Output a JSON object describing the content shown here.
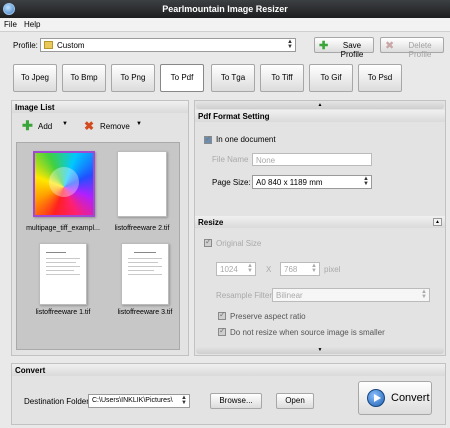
{
  "window": {
    "title": "Pearlmountain Image Resizer"
  },
  "menu": {
    "file": "File",
    "help": "Help"
  },
  "profile": {
    "label": "Profile:",
    "value": "Custom",
    "save": "Save Profile",
    "delete": "Delete Profile"
  },
  "tabs": [
    "To Jpeg",
    "To Bmp",
    "To Png",
    "To Pdf",
    "To Tga",
    "To Tiff",
    "To Gif",
    "To Psd"
  ],
  "active_tab": "To Pdf",
  "image_list": {
    "title": "Image List",
    "add": "Add",
    "remove": "Remove",
    "items": [
      "multipage_tiff_exampl...",
      "listoffreeware 2.tif",
      "listoffreeware 1.tif",
      "listoffreeware 3.tif"
    ]
  },
  "pdf": {
    "title": "Pdf Format Setting",
    "one_document": "In one document",
    "file_name_label": "File Name",
    "file_name_value": "None",
    "page_size_label": "Page Size:",
    "page_size_value": "A0 840 x 1189 mm"
  },
  "resize": {
    "title": "Resize",
    "original_size": "Original Size",
    "width": "1024",
    "x": "X",
    "height": "768",
    "unit": "pixel",
    "filter_label": "Resample Filter",
    "filter_value": "Bilinear",
    "aspect": "Preserve aspect ratio",
    "no_resize": "Do not resize when source image is smaller"
  },
  "convert": {
    "title": "Convert",
    "dest_label": "Destination Folder:",
    "dest_value": "C:\\Users\\INKLIK\\Pictures\\",
    "browse": "Browse...",
    "open": "Open",
    "convert": "Convert"
  },
  "colors": {
    "titlebar": "#2a2b2d",
    "accent_green": "#3aa53a",
    "remove_red": "#d24a1e",
    "convert_icon": "#2e6fc0"
  }
}
